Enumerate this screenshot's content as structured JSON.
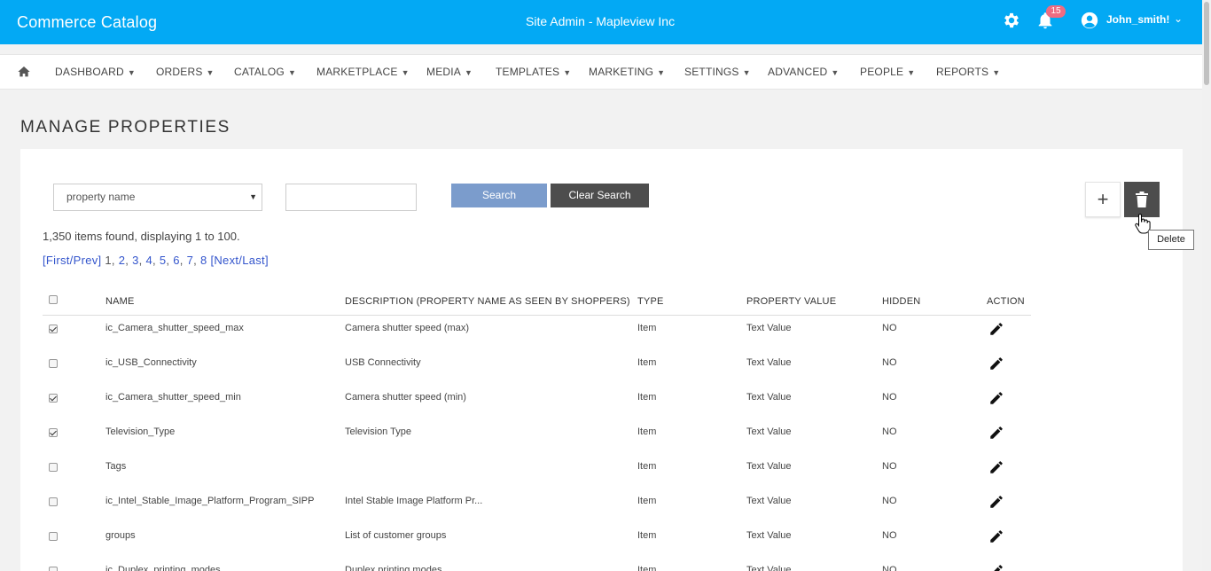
{
  "header": {
    "brand": "Commerce Catalog",
    "site": "Site Admin - Mapleview Inc",
    "notification_count": "15",
    "username": "John_smith!",
    "brand_color": "#03a9f4"
  },
  "nav": {
    "items": [
      {
        "label": "DASHBOARD"
      },
      {
        "label": "ORDERS"
      },
      {
        "label": "CATALOG"
      },
      {
        "label": "MARKETPLACE"
      },
      {
        "label": "MEDIA"
      },
      {
        "label": "TEMPLATES"
      },
      {
        "label": "MARKETING"
      },
      {
        "label": "SETTINGS"
      },
      {
        "label": "ADVANCED"
      },
      {
        "label": "PEOPLE"
      },
      {
        "label": "REPORTS"
      }
    ]
  },
  "page": {
    "title": "MANAGE PROPERTIES"
  },
  "search": {
    "field_select": "property name",
    "query_value": "",
    "search_label": "Search",
    "clear_label": "Clear Search"
  },
  "actions": {
    "add_label": "+",
    "delete_tooltip": "Delete"
  },
  "results": {
    "count_text": "1,350 items found, displaying 1 to 100.",
    "pager_prefix": "[First/Prev]",
    "current_page": "1",
    "pages": [
      "2",
      "3",
      "4",
      "5",
      "6",
      "7",
      "8"
    ],
    "pager_suffix": "[Next/Last]"
  },
  "table": {
    "columns": [
      "NAME",
      "DESCRIPTION (PROPERTY NAME AS SEEN BY SHOPPERS)",
      "TYPE",
      "PROPERTY VALUE",
      "HIDDEN",
      "ACTION"
    ],
    "rows": [
      {
        "checked": true,
        "name": "ic_Camera_shutter_speed_max",
        "description": "Camera shutter speed (max)",
        "type": "Item",
        "value": "Text Value",
        "hidden": "NO"
      },
      {
        "checked": false,
        "name": "ic_USB_Connectivity",
        "description": "USB Connectivity",
        "type": "Item",
        "value": "Text Value",
        "hidden": "NO"
      },
      {
        "checked": true,
        "name": "ic_Camera_shutter_speed_min",
        "description": "Camera shutter speed (min)",
        "type": "Item",
        "value": "Text Value",
        "hidden": "NO"
      },
      {
        "checked": true,
        "name": "Television_Type",
        "description": "Television Type",
        "type": "Item",
        "value": "Text Value",
        "hidden": "NO"
      },
      {
        "checked": false,
        "name": "Tags",
        "description": "",
        "type": "Item",
        "value": "Text Value",
        "hidden": "NO"
      },
      {
        "checked": false,
        "name": "ic_Intel_Stable_Image_Platform_Program_SIPP",
        "description": "Intel Stable Image Platform Pr...",
        "type": "Item",
        "value": "Text Value",
        "hidden": "NO"
      },
      {
        "checked": false,
        "name": "groups",
        "description": "List of customer groups",
        "type": "Item",
        "value": "Text Value",
        "hidden": "NO"
      },
      {
        "checked": false,
        "name": "ic_Duplex_printing_modes",
        "description": "Duplex printing modes",
        "type": "Item",
        "value": "Text Value",
        "hidden": "NO"
      }
    ]
  }
}
